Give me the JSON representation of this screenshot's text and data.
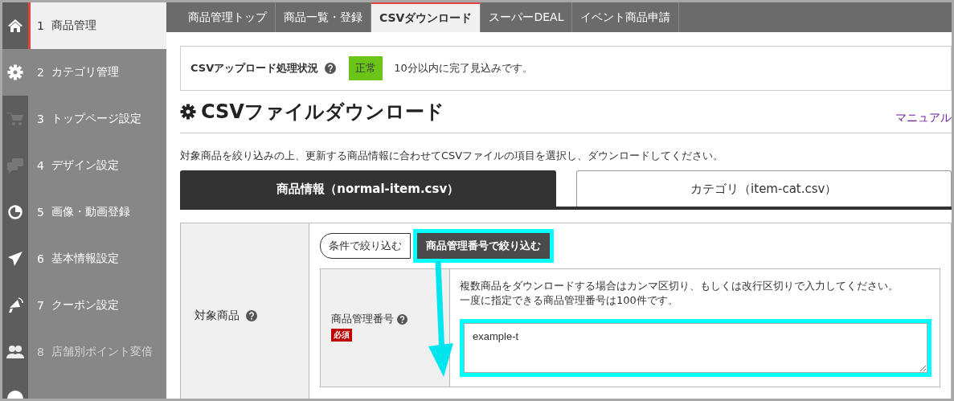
{
  "sidebar": {
    "items": [
      {
        "number": "1",
        "label": "商品管理",
        "selected": true,
        "disabled": false
      },
      {
        "number": "2",
        "label": "カテゴリ管理",
        "selected": false,
        "disabled": false
      },
      {
        "number": "3",
        "label": "トップページ設定",
        "selected": false,
        "disabled": false
      },
      {
        "number": "4",
        "label": "デザイン設定",
        "selected": false,
        "disabled": false
      },
      {
        "number": "5",
        "label": "画像・動画登録",
        "selected": false,
        "disabled": false
      },
      {
        "number": "6",
        "label": "基本情報設定",
        "selected": false,
        "disabled": false
      },
      {
        "number": "7",
        "label": "クーポン設定",
        "selected": false,
        "disabled": false
      },
      {
        "number": "8",
        "label": "店舗別ポイント変倍",
        "selected": false,
        "disabled": true
      }
    ]
  },
  "nav_tabs": [
    {
      "label": "商品管理トップ",
      "selected": false
    },
    {
      "label": "商品一覧・登録",
      "selected": false
    },
    {
      "label": "CSVダウンロード",
      "selected": true
    },
    {
      "label": "スーパーDEAL",
      "selected": false
    },
    {
      "label": "イベント商品申請",
      "selected": false
    }
  ],
  "upload_status": {
    "label": "CSVアップロード処理状況",
    "status": "正常",
    "message": "10分以内に完了見込みです。"
  },
  "heading": "CSVファイルダウンロード",
  "manual_link": "マニュアル",
  "description": "対象商品を絞り込みの上、更新する商品情報に合わせてCSVファイルの項目を選択し、ダウンロードしてください。",
  "file_tabs": [
    {
      "label": "商品情報（normal-item.csv）",
      "selected": true
    },
    {
      "label": "カテゴリ（item-cat.csv）",
      "selected": false
    }
  ],
  "form": {
    "label": "対象商品",
    "filter_modes": [
      {
        "label": "条件で絞り込む",
        "selected": false
      },
      {
        "label": "商品管理番号で絞り込む",
        "selected": true
      }
    ],
    "field": {
      "label": "商品管理番号",
      "required_badge": "必須",
      "hints": [
        "複数商品をダウンロードする場合はカンマ区切り、もしくは改行区切りで入力してください。",
        "一度に指定できる商品管理番号は100件です。"
      ],
      "value": "example-t"
    }
  }
}
